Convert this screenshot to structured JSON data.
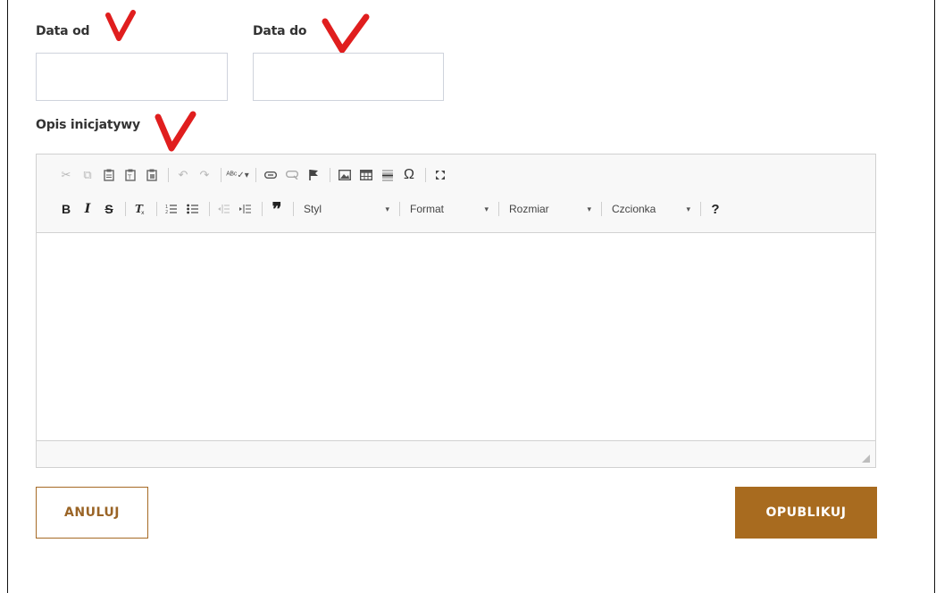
{
  "form": {
    "date_from": {
      "label": "Data od",
      "value": ""
    },
    "date_to": {
      "label": "Data do",
      "value": ""
    },
    "description": {
      "label": "Opis inicjatywy"
    }
  },
  "annotations": {
    "check_mark_color": "#e01e1e"
  },
  "editor": {
    "toolbar_row1": [
      "cut-icon",
      "copy-icon",
      "paste-icon",
      "paste-text-icon",
      "paste-word-icon",
      "undo-icon",
      "redo-icon",
      "spellcheck-icon",
      "link-icon",
      "unlink-icon",
      "anchor-icon",
      "image-icon",
      "table-icon",
      "horizontal-rule-icon",
      "special-char-icon",
      "maximize-icon"
    ],
    "toolbar_row2": [
      "bold-icon",
      "italic-icon",
      "strike-icon",
      "remove-format-icon",
      "numbered-list-icon",
      "bulleted-list-icon",
      "outdent-icon",
      "indent-icon",
      "blockquote-icon",
      "help-icon"
    ],
    "combos": {
      "style": "Styl",
      "format": "Format",
      "size": "Rozmiar",
      "font": "Czcionka"
    },
    "glyphs": {
      "bold": "B",
      "italic": "I",
      "strike": "S",
      "blockquote": "❞",
      "help": "?",
      "special_char": "Ω"
    }
  },
  "buttons": {
    "cancel": "ANULUJ",
    "publish": "OPUBLIKUJ"
  },
  "colors": {
    "accent": "#a86b1f",
    "input_border": "#cfd3dc",
    "toolbar_bg": "#f8f8f8"
  }
}
